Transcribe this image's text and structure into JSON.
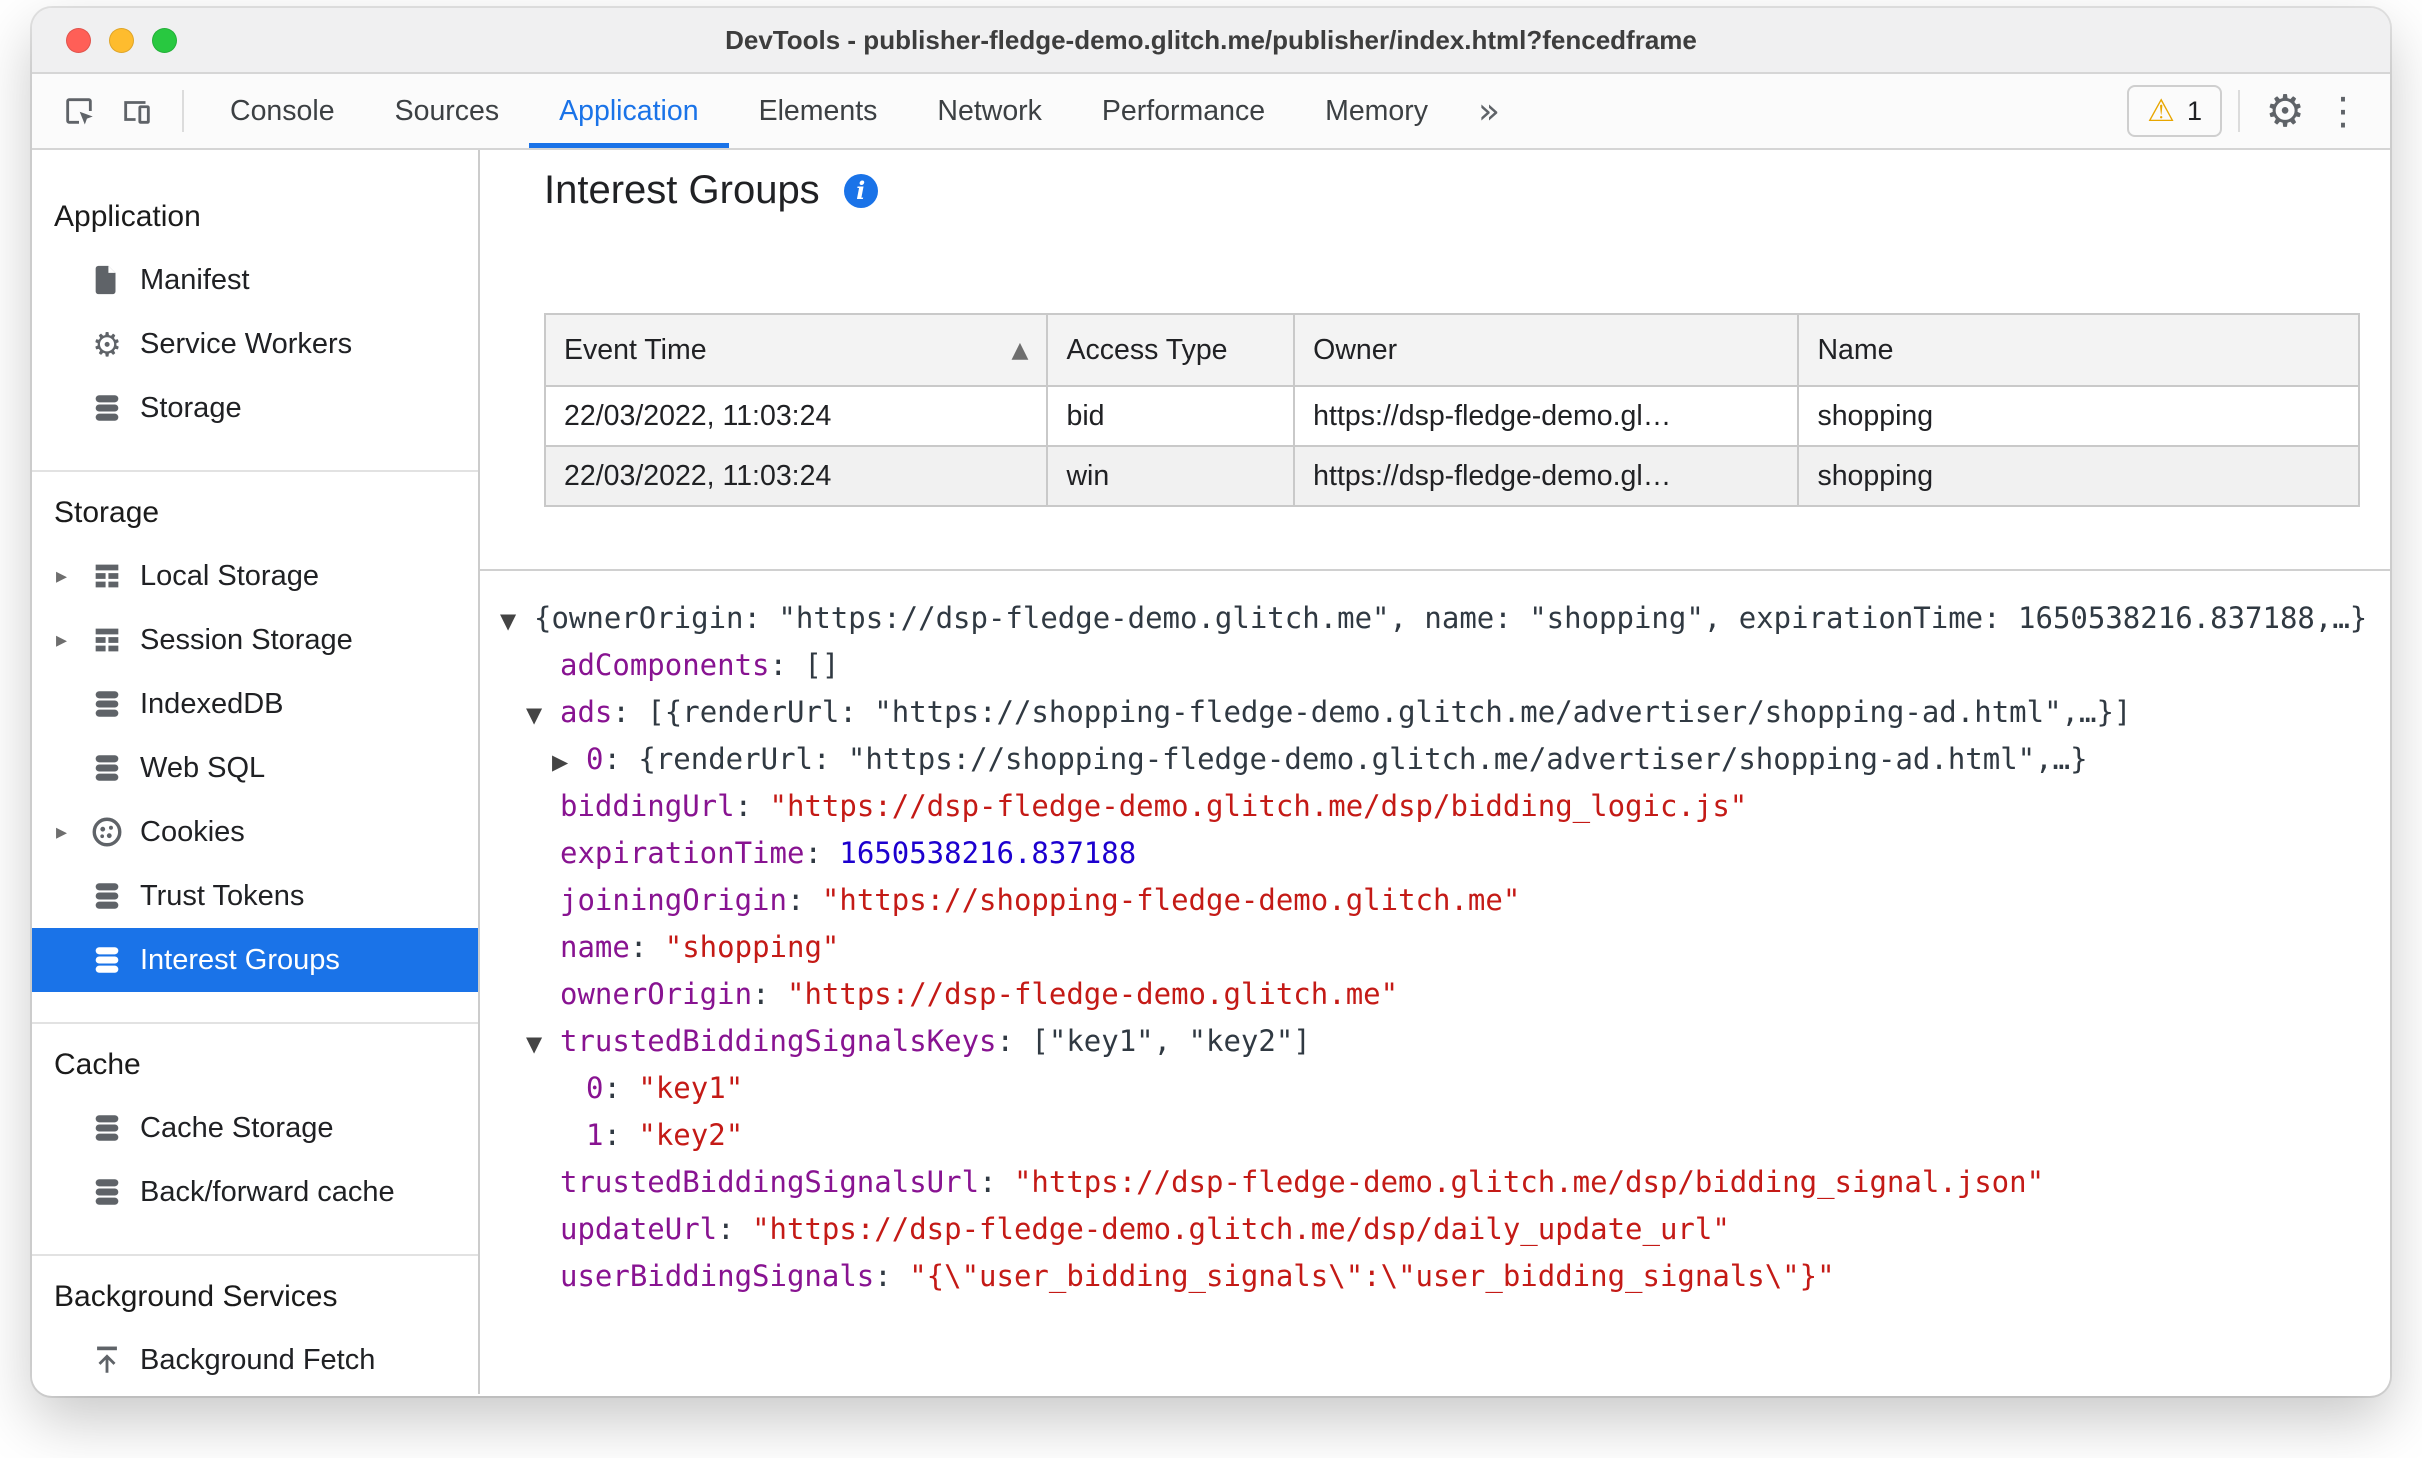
{
  "window": {
    "title": "DevTools - publisher-fledge-demo.glitch.me/publisher/index.html?fencedframe"
  },
  "colors": {
    "accent_blue": "#1a73e8",
    "selection_blue": "#1a73e8",
    "key_purple": "#881391",
    "string_red": "#c41a16",
    "number_blue": "#1c00cf",
    "warning_yellow": "#e8a600",
    "traffic_red": "#ff5f57",
    "traffic_yellow": "#febc2e",
    "traffic_green": "#28c840"
  },
  "toolbar": {
    "tabs": [
      {
        "label": "Console",
        "active": false
      },
      {
        "label": "Sources",
        "active": false
      },
      {
        "label": "Application",
        "active": true
      },
      {
        "label": "Elements",
        "active": false
      },
      {
        "label": "Network",
        "active": false
      },
      {
        "label": "Performance",
        "active": false
      },
      {
        "label": "Memory",
        "active": false
      }
    ],
    "warning_count": "1"
  },
  "sidebar": {
    "sections": [
      {
        "title": "Application",
        "items": [
          {
            "label": "Manifest",
            "icon": "document-icon"
          },
          {
            "label": "Service Workers",
            "icon": "gear-icon"
          },
          {
            "label": "Storage",
            "icon": "database-icon"
          }
        ]
      },
      {
        "title": "Storage",
        "items": [
          {
            "label": "Local Storage",
            "icon": "grid-icon",
            "expandable": true
          },
          {
            "label": "Session Storage",
            "icon": "grid-icon",
            "expandable": true
          },
          {
            "label": "IndexedDB",
            "icon": "database-icon"
          },
          {
            "label": "Web SQL",
            "icon": "database-icon"
          },
          {
            "label": "Cookies",
            "icon": "cookie-icon",
            "expandable": true
          },
          {
            "label": "Trust Tokens",
            "icon": "database-icon"
          },
          {
            "label": "Interest Groups",
            "icon": "database-icon",
            "selected": true
          }
        ]
      },
      {
        "title": "Cache",
        "items": [
          {
            "label": "Cache Storage",
            "icon": "database-icon"
          },
          {
            "label": "Back/forward cache",
            "icon": "database-icon"
          }
        ]
      },
      {
        "title": "Background Services",
        "items": [
          {
            "label": "Background Fetch",
            "icon": "fetch-icon"
          }
        ]
      }
    ]
  },
  "main": {
    "title": "Interest Groups",
    "table": {
      "columns": [
        "Event Time",
        "Access Type",
        "Owner",
        "Name"
      ],
      "sorted_column": "Event Time",
      "sort_direction": "asc",
      "rows": [
        [
          "22/03/2022, 11:03:24",
          "bid",
          "https://dsp-fledge-demo.gl…",
          "shopping"
        ],
        [
          "22/03/2022, 11:03:24",
          "win",
          "https://dsp-fledge-demo.gl…",
          "shopping"
        ]
      ]
    },
    "tree": {
      "lines": [
        {
          "indent": 0,
          "expander": "down",
          "segments": [
            [
              "plain",
              "{ownerOrigin: \"https://dsp-fledge-demo.glitch.me\", name: \"shopping\", expirationTime: 1650538216.837188,…}"
            ]
          ]
        },
        {
          "indent": 1,
          "expander": "none",
          "segments": [
            [
              "key",
              "adComponents"
            ],
            [
              "plain",
              ": []"
            ]
          ]
        },
        {
          "indent": 1,
          "expander": "down",
          "segments": [
            [
              "key",
              "ads"
            ],
            [
              "plain",
              ": [{renderUrl: \"https://shopping-fledge-demo.glitch.me/advertiser/shopping-ad.html\",…}]"
            ]
          ]
        },
        {
          "indent": 2,
          "expander": "right",
          "segments": [
            [
              "key",
              "0"
            ],
            [
              "plain",
              ": {renderUrl: \"https://shopping-fledge-demo.glitch.me/advertiser/shopping-ad.html\",…}"
            ]
          ]
        },
        {
          "indent": 1,
          "expander": "none",
          "segments": [
            [
              "key",
              "biddingUrl"
            ],
            [
              "plain",
              ": "
            ],
            [
              "str",
              "\"https://dsp-fledge-demo.glitch.me/dsp/bidding_logic.js\""
            ]
          ]
        },
        {
          "indent": 1,
          "expander": "none",
          "segments": [
            [
              "key",
              "expirationTime"
            ],
            [
              "plain",
              ": "
            ],
            [
              "num",
              "1650538216.837188"
            ]
          ]
        },
        {
          "indent": 1,
          "expander": "none",
          "segments": [
            [
              "key",
              "joiningOrigin"
            ],
            [
              "plain",
              ": "
            ],
            [
              "str",
              "\"https://shopping-fledge-demo.glitch.me\""
            ]
          ]
        },
        {
          "indent": 1,
          "expander": "none",
          "segments": [
            [
              "key",
              "name"
            ],
            [
              "plain",
              ": "
            ],
            [
              "str",
              "\"shopping\""
            ]
          ]
        },
        {
          "indent": 1,
          "expander": "none",
          "segments": [
            [
              "key",
              "ownerOrigin"
            ],
            [
              "plain",
              ": "
            ],
            [
              "str",
              "\"https://dsp-fledge-demo.glitch.me\""
            ]
          ]
        },
        {
          "indent": 1,
          "expander": "down",
          "segments": [
            [
              "key",
              "trustedBiddingSignalsKeys"
            ],
            [
              "plain",
              ": [\"key1\", \"key2\"]"
            ]
          ]
        },
        {
          "indent": 2,
          "expander": "none",
          "segments": [
            [
              "key",
              "0"
            ],
            [
              "plain",
              ": "
            ],
            [
              "str",
              "\"key1\""
            ]
          ]
        },
        {
          "indent": 2,
          "expander": "none",
          "segments": [
            [
              "key",
              "1"
            ],
            [
              "plain",
              ": "
            ],
            [
              "str",
              "\"key2\""
            ]
          ]
        },
        {
          "indent": 1,
          "expander": "none",
          "segments": [
            [
              "key",
              "trustedBiddingSignalsUrl"
            ],
            [
              "plain",
              ": "
            ],
            [
              "str",
              "\"https://dsp-fledge-demo.glitch.me/dsp/bidding_signal.json\""
            ]
          ]
        },
        {
          "indent": 1,
          "expander": "none",
          "segments": [
            [
              "key",
              "updateUrl"
            ],
            [
              "plain",
              ": "
            ],
            [
              "str",
              "\"https://dsp-fledge-demo.glitch.me/dsp/daily_update_url\""
            ]
          ]
        },
        {
          "indent": 1,
          "expander": "none",
          "segments": [
            [
              "key",
              "userBiddingSignals"
            ],
            [
              "plain",
              ": "
            ],
            [
              "str",
              "\"{\\\"user_bidding_signals\\\":\\\"user_bidding_signals\\\"}\""
            ]
          ]
        }
      ]
    }
  }
}
